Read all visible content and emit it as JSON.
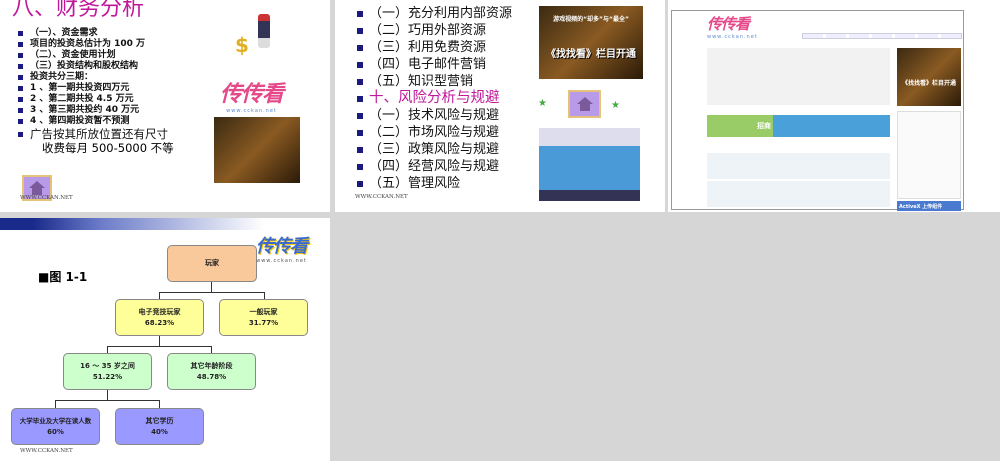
{
  "slide1": {
    "title": "八、财务分析",
    "bullets": [
      "（一）、资金需求",
      "项目的投资总估计为 100 万",
      "（二）、资金使用计划",
      "（三）投资结构和股权结构",
      "投资共分三期：",
      "1 、第一期共投资四万元",
      "2 、第二期共投 4.5 万元",
      "3 、第三期共投约 40 万元",
      "4 、第四期投资暂不预测"
    ],
    "big_bullet": [
      "广告按其所放位置还有尺寸",
      "收费每月 500-5000 不等"
    ],
    "logo": "传传看",
    "logo_url": "www.cckan.net",
    "footer": "WWW.CCKAN.NET"
  },
  "slide2": {
    "bullets": [
      "（一）充分利用内部资源",
      "（二）巧用外部资源",
      "（三）利用免费资源",
      "（四）电子邮件营销",
      "（五）知识型营销"
    ],
    "heading": "十、风险分析与规避",
    "risk_bullets": [
      "（一）技术风险与规避",
      "（二）市场风险与规避",
      "（三）政策风险与规避",
      "（四）经营风险与规避",
      "（五）管理风险"
    ],
    "banner_text": "《找找看》栏目开通",
    "banner_sub": "游戏视频的“却多”与“最全”",
    "footer": "WWW.CCKAN.NET"
  },
  "slide3": {
    "logo": "传传看",
    "logo_url": "www.cckan.net",
    "banner_text": "《找找看》栏目开通",
    "ad_text": "ActiveX 上传组件",
    "ad_logo": "招商"
  },
  "slide4": {
    "label": "图 1-1",
    "logo": "传传看",
    "logo_url": "www.cckan.net",
    "footer": "WWW.CCKAN.NET",
    "nodes": {
      "root": {
        "name": "玩家"
      },
      "esports": {
        "name": "电子竞技玩家",
        "pct": "68.23%"
      },
      "general": {
        "name": "一般玩家",
        "pct": "31.77%"
      },
      "age": {
        "name": "16 ～ 35 岁之间",
        "pct": "51.22%"
      },
      "otherage": {
        "name": "其它年龄阶段",
        "pct": "48.78%"
      },
      "college": {
        "name": "大学毕业及大学在读人数",
        "pct": "60%"
      },
      "otheredu": {
        "name": "其它学历",
        "pct": "40%"
      }
    },
    "colors": {
      "root": "#f9c89b",
      "l1": "#ffff99",
      "l2": "#ccffcc",
      "l3": "#9999ff"
    }
  }
}
